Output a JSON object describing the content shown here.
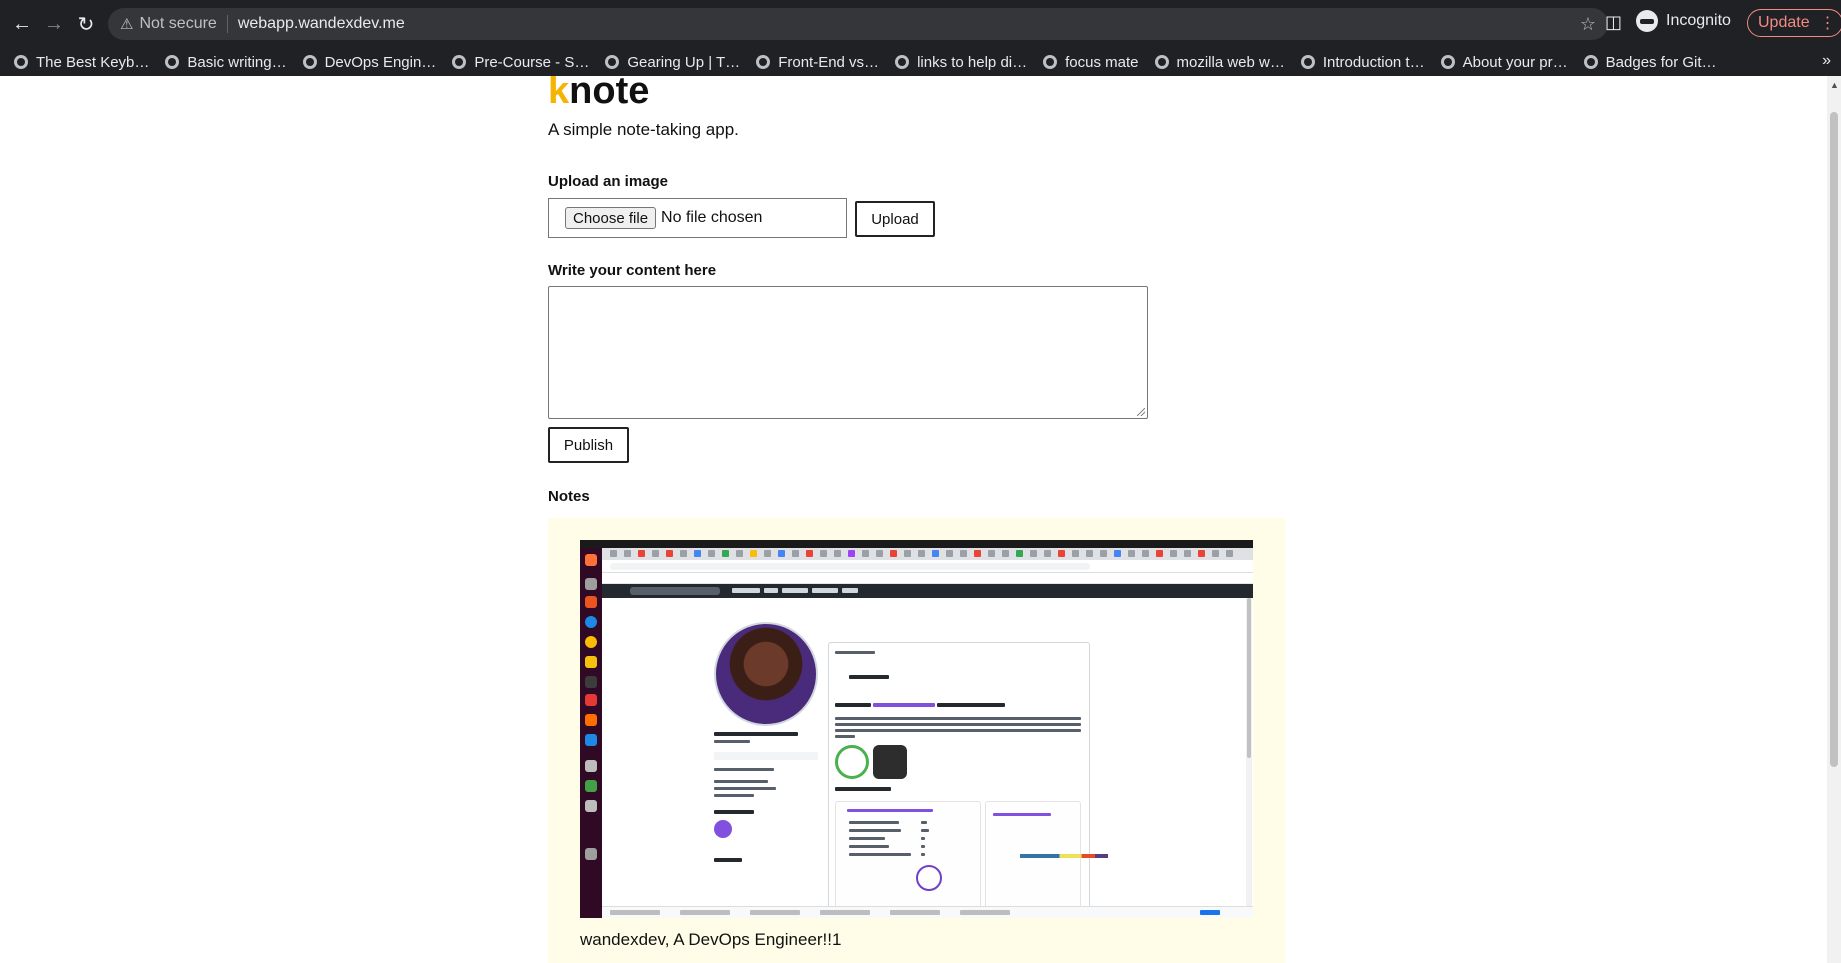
{
  "browser": {
    "security_label": "Not secure",
    "url": "webapp.wandexdev.me",
    "profile_label": "Incognito",
    "update_label": "Update",
    "bookmarks": [
      "The Best Keyb…",
      "Basic writing…",
      "DevOps Engin…",
      "Pre-Course - S…",
      "Gearing Up | T…",
      "Front-End vs…",
      "links to help di…",
      "focus mate",
      "mozilla web w…",
      "Introduction t…",
      "About your pr…",
      "Badges for Git…"
    ],
    "bookmarks_more": "»"
  },
  "app": {
    "logo_accent": "k",
    "logo_rest": "note",
    "tagline": "A simple note-taking app.",
    "upload_heading": "Upload an image",
    "choose_file_label": "Choose file",
    "no_file_label": "No file chosen",
    "upload_button": "Upload",
    "content_heading": "Write your content here",
    "content_value": "",
    "publish_button": "Publish",
    "notes_heading": "Notes",
    "notes": [
      {
        "caption": "wandexdev, A DevOps Engineer!!1"
      }
    ]
  },
  "colors": {
    "logo_accent": "#f5b400",
    "note_background": "#fffde8",
    "browser_frame": "#202124",
    "update_accent": "#f28b82"
  }
}
